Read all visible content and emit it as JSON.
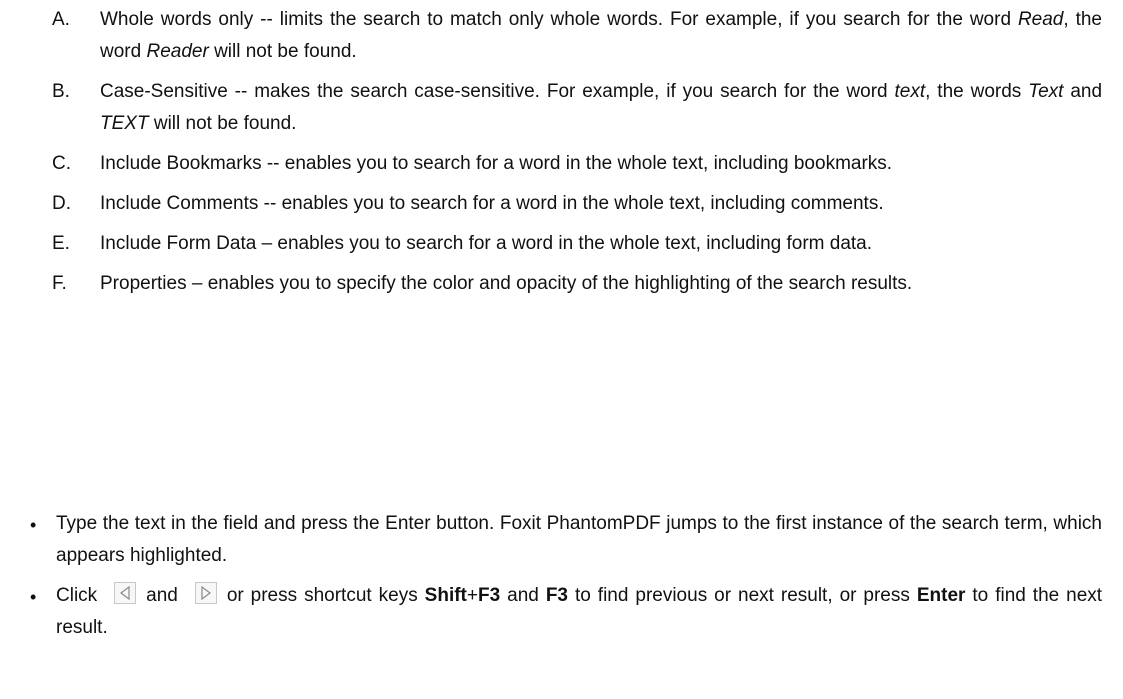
{
  "options": [
    {
      "letter": "A.",
      "parts": [
        {
          "t": "Whole words only -- limits the search to match only whole words. For example, if you search for the word "
        },
        {
          "t": "Read",
          "i": true
        },
        {
          "t": ", the word "
        },
        {
          "t": "Reader",
          "i": true
        },
        {
          "t": " will not be found."
        }
      ]
    },
    {
      "letter": "B.",
      "parts": [
        {
          "t": "Case-Sensitive -- makes the search case-sensitive. For example, if you search for the word "
        },
        {
          "t": "text",
          "i": true
        },
        {
          "t": ", the words "
        },
        {
          "t": "Text",
          "i": true
        },
        {
          "t": " and "
        },
        {
          "t": "TEXT",
          "i": true
        },
        {
          "t": " will not be found."
        }
      ]
    },
    {
      "letter": "C.",
      "parts": [
        {
          "t": "Include Bookmarks -- enables you to search for a word in the whole text, including bookmarks."
        }
      ]
    },
    {
      "letter": "D.",
      "parts": [
        {
          "t": "Include Comments -- enables you to search for a word in the whole text, including comments."
        }
      ]
    },
    {
      "letter": "E.",
      "parts": [
        {
          "t": "Include Form Data – enables you to search for a word in the whole text, including form data."
        }
      ]
    },
    {
      "letter": "F.",
      "parts": [
        {
          "t": "Properties – enables you to specify the color and opacity of the highlighting of the search results."
        }
      ]
    }
  ],
  "bullets": {
    "mark": "•",
    "first": "Type the text in the field and press the Enter button. Foxit PhantomPDF jumps to the first instance of the search term, which appears highlighted.",
    "second": {
      "click": "Click",
      "and": "and",
      "or_press": "or press shortcut keys",
      "shift": "Shift",
      "plus": "+",
      "f3a": "F3",
      "and2": "and",
      "f3b": "F3",
      "rest": "to find previous or next result, or press",
      "enter": "Enter",
      "end": "to find the next result."
    },
    "icons": {
      "prev": "previous-result-icon",
      "next": "next-result-icon"
    }
  }
}
